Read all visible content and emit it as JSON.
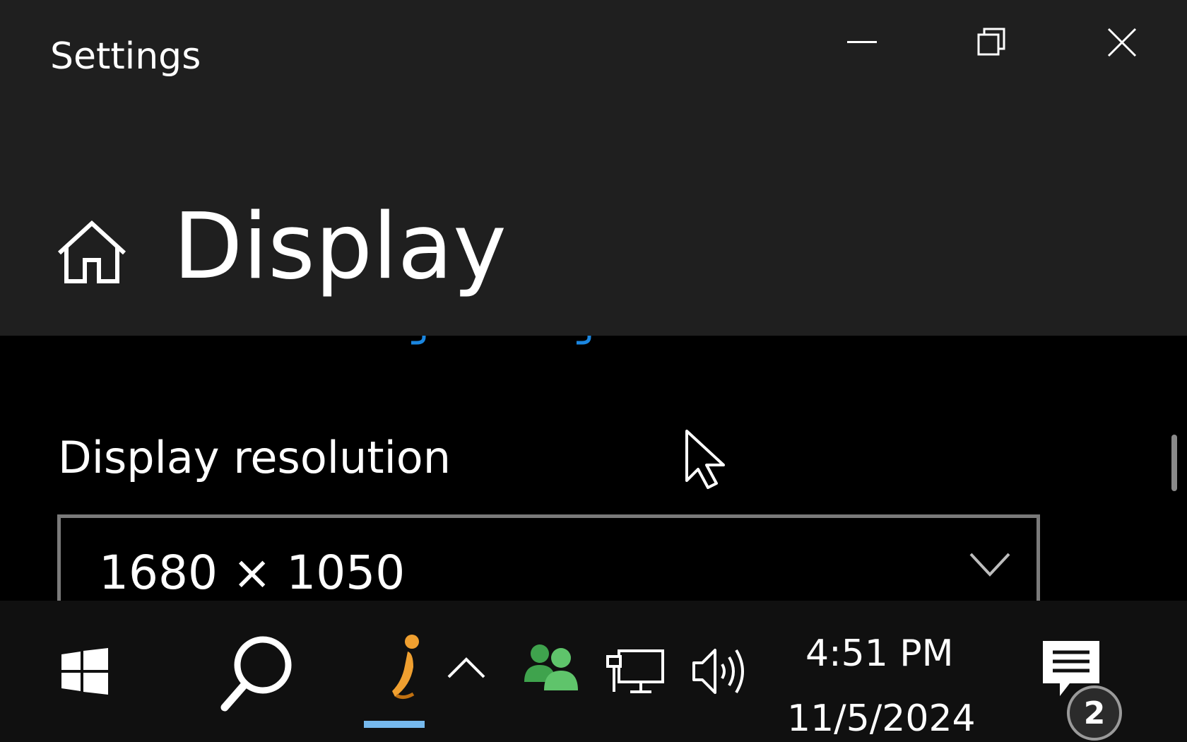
{
  "window": {
    "app_title": "Settings",
    "controls": {
      "minimize_icon": "minimize-icon",
      "maximize_icon": "restore-icon",
      "close_icon": "close-icon"
    }
  },
  "header": {
    "home_icon": "home-icon",
    "page_title": "Display"
  },
  "content": {
    "resolution_label": "Display resolution",
    "resolution_select": {
      "selected_value": "1680 × 1050",
      "icon": "chevron-down-icon"
    }
  },
  "taskbar": {
    "start_icon": "windows-logo-icon",
    "search_icon": "search-icon",
    "tray": {
      "overflow_icon": "chevron-up-icon",
      "people_icon": "people-icon",
      "network_icon": "network-icon",
      "volume_icon": "volume-icon"
    },
    "clock": {
      "time": "4:51 PM",
      "date": "11/5/2024"
    },
    "action_center": {
      "icon": "notification-icon",
      "badge_count": "2"
    }
  },
  "colors": {
    "header_bg": "#1f1f1f",
    "content_bg": "#000000",
    "taskbar_bg": "#101010",
    "accent": "#0078d7",
    "active_indicator": "#76b9ed",
    "dropdown_border": "#7a7a7a"
  }
}
